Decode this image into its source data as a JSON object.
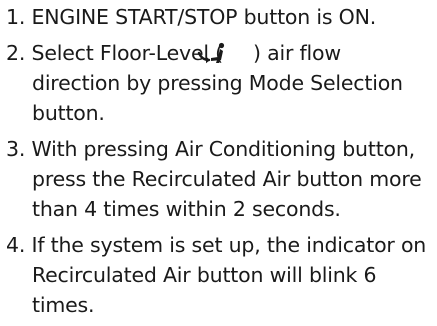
{
  "steps": [
    {
      "number": "1.",
      "text": "ENGINE START/STOP button is ON."
    },
    {
      "number": "2.",
      "text_before_icon": "Select Floor-Level (",
      "icon": "floor-airflow-icon",
      "text_after_icon": ") air flow direction by pressing Mode Selection button."
    },
    {
      "number": "3.",
      "text": "With pressing Air Conditioning button, press the Recirculated Air button more than 4 times within 2 seconds."
    },
    {
      "number": "4.",
      "text": "If the system is set up, the indicator on Recirculated Air button will blink 6 times."
    }
  ]
}
